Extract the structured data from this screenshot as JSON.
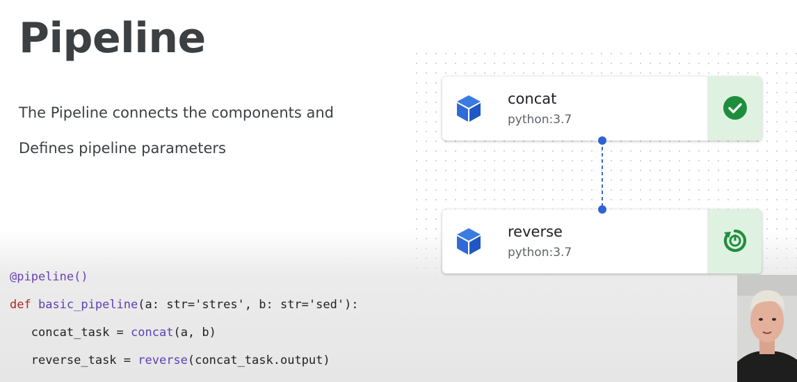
{
  "slide": {
    "title": "Pipeline",
    "description_line1": "The Pipeline connects the components and",
    "description_line2": "Defines pipeline parameters"
  },
  "code": {
    "line1": "@pipeline()",
    "line2_kw": "def",
    "line2_fn": "basic_pipeline",
    "line2_rest": "(a: str='stres', b: str='sed'):",
    "line3_var": "concat_task",
    "line3_eq": " = ",
    "line3_fn": "concat",
    "line3_rest": "(a, b)",
    "line4_var": "reverse_task",
    "line4_eq": " = ",
    "line4_fn": "reverse",
    "line4_rest": "(concat_task.output)"
  },
  "graph": {
    "nodes": [
      {
        "name": "concat",
        "version": "python:3.7",
        "status": "succeeded",
        "status_icon": "check-circle-icon"
      },
      {
        "name": "reverse",
        "version": "python:3.7",
        "status": "running",
        "status_icon": "refresh-circle-icon"
      }
    ],
    "colors": {
      "cube": "#2f6ad9",
      "status_bg": "#dff1e0",
      "status_icon": "#1e8e3e",
      "edge": "#3b6bd6"
    }
  }
}
